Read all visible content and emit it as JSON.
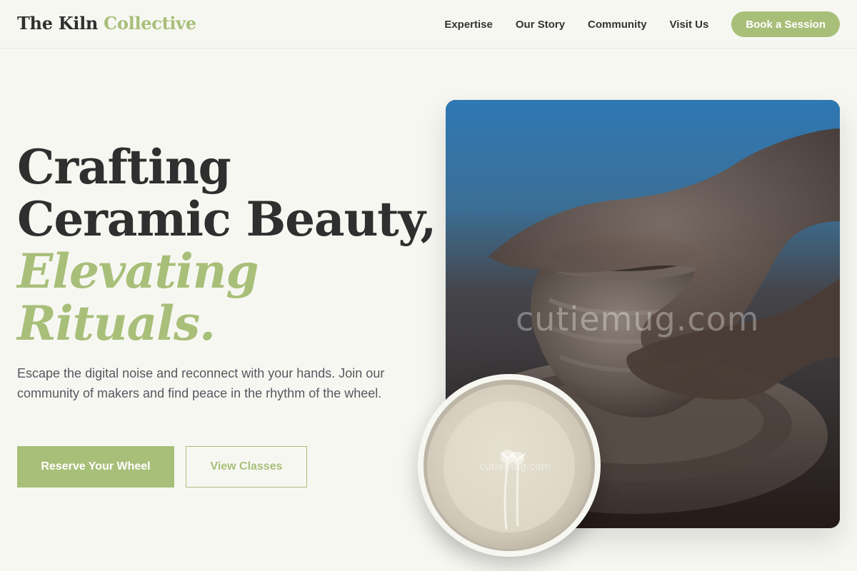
{
  "header": {
    "brand_primary": "The Kiln",
    "brand_accent": "Collective",
    "nav": [
      "Expertise",
      "Our Story",
      "Community",
      "Visit Us"
    ],
    "cta": "Book a Session"
  },
  "hero": {
    "title_lines": [
      "Crafting",
      "Ceramic Beauty,"
    ],
    "title_accent_lines": [
      "Elevating",
      "Rituals."
    ],
    "subtitle": "Escape the digital noise and reconnect with your hands. Join our community of makers and find peace in the rhythm of the wheel.",
    "primary_button": "Reserve Your Wheel",
    "secondary_button": "View Classes"
  },
  "images": {
    "main": {
      "subject": "hands-shaping-clay-pot-on-wheel",
      "watermark": "cutiemug.com"
    },
    "circle": {
      "subject": "ceramic-plate-with-dried-flowers",
      "watermark": "cutiemug.com"
    }
  },
  "colors": {
    "accent": "#a8bf79",
    "background": "#f7f7f2",
    "text_dark": "#2f2f2f",
    "text_muted": "#55585f"
  }
}
